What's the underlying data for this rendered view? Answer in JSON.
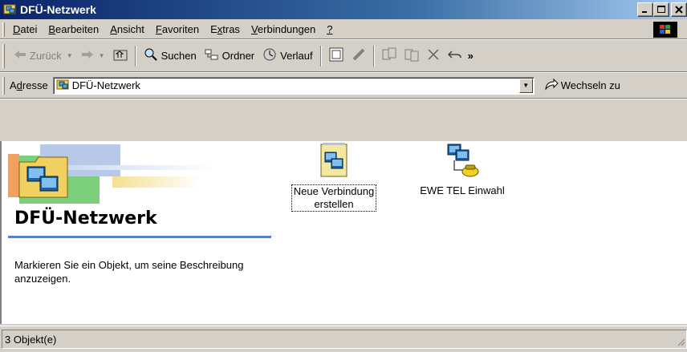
{
  "window": {
    "title": "DFÜ-Netzwerk"
  },
  "menu": [
    {
      "label": "Datei",
      "mnemonic": "D",
      "rest": "atei"
    },
    {
      "label": "Bearbeiten",
      "mnemonic": "B",
      "rest": "earbeiten"
    },
    {
      "label": "Ansicht",
      "mnemonic": "A",
      "rest": "nsicht"
    },
    {
      "label": "Favoriten",
      "mnemonic": "F",
      "rest": "avoriten"
    },
    {
      "label": "Extras",
      "pre": "E",
      "mnemonic": "x",
      "rest": "tras"
    },
    {
      "label": "Verbindungen",
      "mnemonic": "V",
      "rest": "erbindungen"
    },
    {
      "label": "?",
      "mnemonic": "?",
      "rest": ""
    }
  ],
  "toolbar": {
    "back": "Zurück",
    "search": "Suchen",
    "folders": "Ordner",
    "history": "Verlauf",
    "more": "»"
  },
  "address": {
    "label_pre": "A",
    "label_mn": "d",
    "label_rest": "resse",
    "value": "DFÜ-Netzwerk",
    "go": "Wechseln zu"
  },
  "panel": {
    "title": "DFÜ-Netzwerk",
    "description": "Markieren Sie ein Objekt, um seine Beschreibung anzuzeigen."
  },
  "items": [
    {
      "line1": "Neue Verbindung",
      "line2": "erstellen",
      "selected": true
    },
    {
      "line1": "EWE TEL Einwahl",
      "line2": "",
      "selected": false
    }
  ],
  "status": {
    "text": "3 Objekt(e)"
  },
  "colors": {
    "title_start": "#0a246a",
    "title_end": "#a6caf0",
    "face": "#d4d0c8",
    "accent_rule": "#5a84c0"
  }
}
